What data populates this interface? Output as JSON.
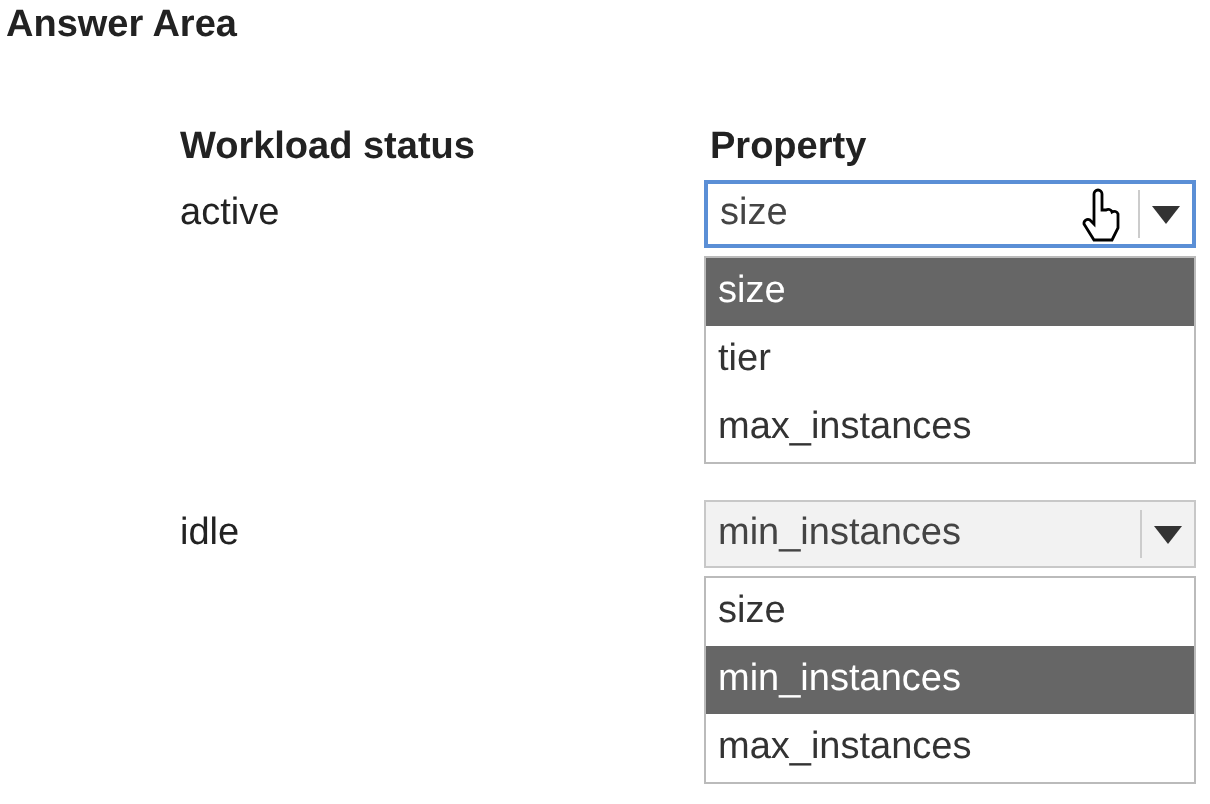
{
  "title": "Answer Area",
  "columns": [
    "Workload status",
    "Property"
  ],
  "rows": [
    {
      "status": "active",
      "dropdown": {
        "value": "size",
        "focused": true,
        "pointer": true,
        "options": [
          {
            "label": "size",
            "selected": true
          },
          {
            "label": "tier",
            "selected": false
          },
          {
            "label": "max_instances",
            "selected": false
          }
        ]
      }
    },
    {
      "status": "idle",
      "dropdown": {
        "value": "min_instances",
        "focused": false,
        "pointer": false,
        "options": [
          {
            "label": "size",
            "selected": false
          },
          {
            "label": "min_instances",
            "selected": true
          },
          {
            "label": "max_instances",
            "selected": false
          }
        ]
      }
    }
  ]
}
